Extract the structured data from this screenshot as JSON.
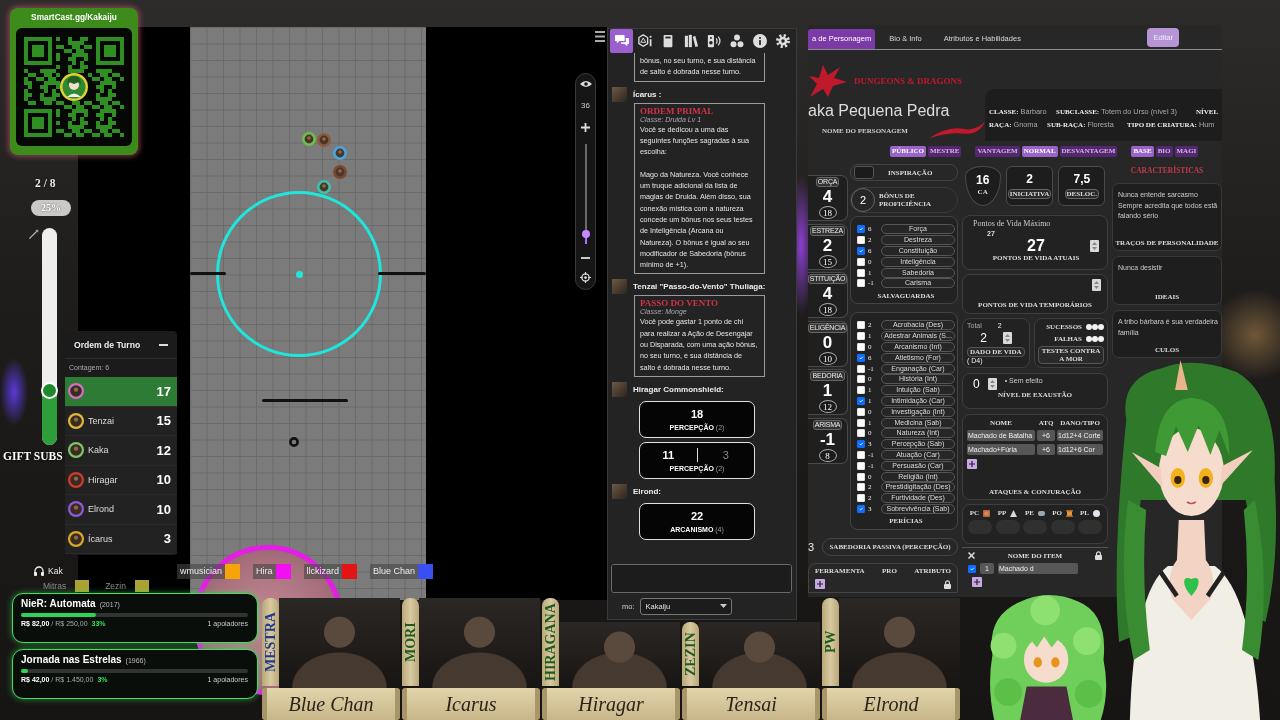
{
  "qr_card": {
    "title": "SmartCast.gg/Kakaiju"
  },
  "sub_goal": {
    "count": "2 / 8",
    "percent": "25%",
    "level": 0.25
  },
  "gift_subs": "GIFT SUBS",
  "map": {
    "zoom": {
      "label": "36",
      "level": 0.1
    },
    "tokens": [
      {
        "color": "#6cc04a"
      },
      {
        "color": "#8a5a3a"
      },
      {
        "color": "#4aa6dc"
      },
      {
        "color": "#7a4a2c"
      },
      {
        "color": "#3fc0a8"
      }
    ]
  },
  "turn_order": {
    "title": "Ordem de Turno",
    "counter": "Contagem: 6",
    "entries": [
      {
        "initiative": "17",
        "color": "#d070c0",
        "selected": true
      },
      {
        "name": "Tenzai",
        "initiative": "15",
        "color": "#e2b83a",
        "selected": false
      },
      {
        "name": "Kaka",
        "initiative": "12",
        "color": "#7cc46a",
        "selected": false
      },
      {
        "name": "Hiragar",
        "initiative": "10",
        "color": "#d23a2a",
        "selected": false
      },
      {
        "name": "Elrond",
        "initiative": "10",
        "color": "#8e5ad8",
        "selected": false
      },
      {
        "name": "Ícarus",
        "initiative": "3",
        "color": "#d8a82a",
        "selected": false
      }
    ]
  },
  "now_playing": "Kak",
  "voice_members": [
    {
      "name": "wmusician",
      "color": "#f5a50a"
    },
    {
      "name": "Hira",
      "color": "#f010f0"
    },
    {
      "name": "llckizard",
      "color": "#e51414"
    },
    {
      "name": "Blue Chan",
      "color": "#3a4ff2"
    }
  ],
  "voice_members_behind": [
    {
      "name": "Mitras",
      "color": "#aaa232"
    },
    {
      "name": "Zezin",
      "color": "#aaa232"
    }
  ],
  "goals": [
    {
      "title": "NieR: Automata",
      "year": "(2017)",
      "level": 0.33,
      "amounts": "**R$ 82,00** / R$ 250,00",
      "percent": "33%",
      "supporters": "1 apoiadores"
    },
    {
      "title": "Jornada nas Estrelas",
      "year": "(1966)",
      "level": 0.03,
      "amounts": "**R$ 42,00** / R$ 1.450,00",
      "percent": "3%",
      "supporters": "1 apoiadores"
    }
  ],
  "chat": {
    "tabs": [
      {
        "selected": true
      },
      {
        "selected": false
      },
      {
        "selected": false
      },
      {
        "selected": false
      },
      {
        "selected": false
      },
      {
        "selected": false
      },
      {
        "selected": false
      },
      {
        "selected": false
      }
    ],
    "messages": [
      {
        "kind": "card",
        "paragraphs": [
          "bônus, no seu turno, e sua distância de salto é dobrada nesse turno."
        ]
      },
      {
        "kind": "card",
        "sender": "Ícarus :",
        "title": "ORDEM PRIMAL",
        "subtitle": "Classe: Druida Lv 1",
        "paragraphs": [
          "Você se dedicou a uma das seguintes funções sagradas à sua escolha:",
          "Mago da Natureza. Você conhece um truque adicional da lista de magias de Druida. Além disso, sua conexão mística com a natureza concede um bônus nos seus testes de Inteligência (Arcana ou Natureza). O bônus é igual ao seu modificador de Sabedoria (bônus mínimo de +1)."
        ]
      },
      {
        "kind": "card",
        "sender": "Tenzai \"Passo-do-Vento\" Thuliaga:",
        "title": "PASSO DO VENTO",
        "subtitle": "Classe: Monge",
        "paragraphs": [
          "Você pode gastar 1 ponto de chi para realizar a Ação de Desengajar ou Disparada, com uma ação bônus, no seu turno, e sua distância de salto é dobrada nesse turno."
        ]
      },
      {
        "kind": "roll",
        "sender": "Hiragar Commonshield:",
        "rolls": [
          {
            "results": [
              {
                "value": "18",
                "dropped": false
              }
            ],
            "label": "**PERCEPÇÃO** (2)"
          },
          {
            "results": [
              {
                "value": "11",
                "dropped": false
              },
              {
                "value": "3",
                "dropped": true
              }
            ],
            "label": "**PERCEPÇÃO** (2)"
          }
        ]
      },
      {
        "kind": "roll",
        "sender": "Elrond:",
        "rolls": [
          {
            "results": [
              {
                "value": "22",
                "dropped": false
              }
            ],
            "label": "**ARCANISMO** (4)"
          }
        ]
      }
    ],
    "speaker": {
      "label": "mo:",
      "value": "Kakaiju"
    }
  },
  "sheet": {
    "tabs": [
      {
        "label": "a de Personagem",
        "selected": true
      },
      {
        "label": "Bio & Info",
        "selected": false
      },
      {
        "label": "Atributos e Habilidades",
        "selected": false
      }
    ],
    "edit_label": "Editar",
    "logo": "DUNGEONS & DRAGONS",
    "character_name": "aka Pequena Pedra",
    "name_caption": "NOME DO PERSONAGEM",
    "info": [
      {
        "label": "CLASSE:",
        "value": "Bárbaro"
      },
      {
        "label": "SUBCLASSE:",
        "value": "Totem do Urso (nível 3)"
      },
      {
        "label": "NÍVEL"
      },
      {
        "label": "RAÇA:",
        "value": "Gnoma"
      },
      {
        "label": "SUB-RAÇA:",
        "value": "Floresta"
      },
      {
        "label": "TIPO DE CRIATURA:",
        "value": "Hum"
      }
    ],
    "toggle_groups": [
      {
        "options": [
          {
            "label": "PÚBLICO",
            "selected": true
          },
          {
            "label": "MESTRE",
            "selected": false
          }
        ]
      },
      {
        "options": [
          {
            "label": "VANTAGEM",
            "selected": false
          },
          {
            "label": "NORMAL",
            "selected": true
          },
          {
            "label": "DESVANTAGEM",
            "selected": false
          }
        ]
      },
      {
        "options": [
          {
            "label": "BASE",
            "selected": true
          },
          {
            "label": "BIO",
            "selected": false
          },
          {
            "label": "MAGI",
            "selected": false
          }
        ]
      }
    ],
    "abilities": [
      {
        "name": "ORÇA",
        "modifier": "4",
        "score": "18"
      },
      {
        "name": "ESTREZA",
        "modifier": "2",
        "score": "15"
      },
      {
        "name": "STITUIÇÃO",
        "modifier": "4",
        "score": "18"
      },
      {
        "name": "ELIGÊNCIA",
        "modifier": "0",
        "score": "10"
      },
      {
        "name": "BEDORIA",
        "modifier": "1",
        "score": "12"
      },
      {
        "name": "ARISMA",
        "modifier": "-1",
        "score": "8"
      }
    ],
    "inspiration": "INSPIRAÇÃO",
    "proficiency": {
      "value": "2",
      "label": "BÔNUS DE PROFICIÊNCIA"
    },
    "saves": {
      "title": "SALVAGUARDAS",
      "items": [
        {
          "value": "6",
          "name": "Força",
          "checked": true
        },
        {
          "value": "2",
          "name": "Destreza",
          "checked": false
        },
        {
          "value": "6",
          "name": "Constituição",
          "checked": true
        },
        {
          "value": "0",
          "name": "Inteligência",
          "checked": false
        },
        {
          "value": "1",
          "name": "Sabedoria",
          "checked": false
        },
        {
          "value": "-1",
          "name": "Carisma",
          "checked": false
        }
      ]
    },
    "skills": {
      "title": "PERÍCIAS",
      "items": [
        {
          "value": "2",
          "name": "Acrobacia (Des)",
          "checked": false
        },
        {
          "value": "1",
          "name": "Adestrar Animais (S...",
          "checked": false
        },
        {
          "value": "0",
          "name": "Arcanismo (Int)",
          "checked": false
        },
        {
          "value": "6",
          "name": "Atletismo (For)",
          "checked": true
        },
        {
          "value": "-1",
          "name": "Enganação (Car)",
          "checked": false
        },
        {
          "value": "0",
          "name": "História (Int)",
          "checked": false
        },
        {
          "value": "1",
          "name": "Intuição (Sab)",
          "checked": false
        },
        {
          "value": "1",
          "name": "Intimidação (Car)",
          "checked": true
        },
        {
          "value": "0",
          "name": "Investigação (Int)",
          "checked": false
        },
        {
          "value": "1",
          "name": "Medicina (Sab)",
          "checked": false
        },
        {
          "value": "0",
          "name": "Natureza (Int)",
          "checked": false
        },
        {
          "value": "3",
          "name": "Percepção (Sab)",
          "checked": true
        },
        {
          "value": "-1",
          "name": "Atuação (Car)",
          "checked": false
        },
        {
          "value": "-1",
          "name": "Persuasão (Car)",
          "checked": false
        },
        {
          "value": "0",
          "name": "Religião (Int)",
          "checked": false
        },
        {
          "value": "2",
          "name": "Prestidigitação (Des)",
          "checked": false
        },
        {
          "value": "2",
          "name": "Furtividade (Des)",
          "checked": false
        },
        {
          "value": "3",
          "name": "Sobrevivência (Sab)",
          "checked": true
        }
      ]
    },
    "passive": {
      "value": "3",
      "label": "SABEDORIA PASSIVA (PERCEPÇÃO)"
    },
    "tools": {
      "columns": [
        "FERRAMENTA",
        "PRO",
        "ATRIBUTO"
      ]
    },
    "combat": [
      {
        "kind": "shield",
        "value": "16",
        "label": "CA"
      },
      {
        "kind": "box",
        "value": "2",
        "label": "INICIATIVA"
      },
      {
        "kind": "box",
        "value": "7,5",
        "label": "DESLOC."
      }
    ],
    "hit_points": {
      "max_label": "Pontos de Vida Máximo",
      "max": "27",
      "current": "27",
      "current_label": "PONTOS DE VIDA ATUAIS",
      "temp_label": "PONTOS DE VIDA TEMPORÁRIOS"
    },
    "hit_dice": {
      "total_label": "Total",
      "total": "2",
      "current": "2",
      "label": "DADO DE VIDA",
      "die": "( D4)"
    },
    "death_saves": {
      "successes_label": "SUCESSOS",
      "failures_label": "FALHAS",
      "label": "TESTES CONTRA A MOR"
    },
    "exhaustion": {
      "value": "0",
      "effect": "• Sem efeito",
      "label": "NÍVEL DE EXAUSTÃO"
    },
    "attacks": {
      "columns": [
        "NOME",
        "ATQ",
        "DANO/TIPO"
      ],
      "rows": [
        {
          "name": "Machado de Batalha",
          "bonus": "+6",
          "damage": "1d12+4 Corte"
        },
        {
          "name": "Machado+Fúria",
          "bonus": "+6",
          "damage": "1d12+6 Cor"
        }
      ],
      "title": "ATAQUES & CONJURAÇÃO"
    },
    "coins": [
      "PC",
      "PP",
      "PE",
      "PO",
      "PL"
    ],
    "inventory": {
      "column": "NOME DO ITEM",
      "items": [
        {
          "checked": true,
          "quantity": "1",
          "name": "Machado d"
        }
      ]
    },
    "traits": {
      "title": "CARACTERÍSTICAS",
      "sections": [
        {
          "lines": [
            "Nunca entende sarcasmo",
            "Sempre acredita que todos estã",
            "falando sério"
          ],
          "label": "TRAÇOS DE PERSONALIDADE"
        },
        {
          "lines": [
            "Nunca desistir"
          ],
          "label": "IDEAIS"
        },
        {
          "lines": [
            "A tribo bárbara é sua verdadeira",
            "família"
          ],
          "label": "CULOS"
        }
      ]
    }
  },
  "cast": [
    {
      "tag": "MESTRA",
      "kind": "master",
      "name": "Blue Chan"
    },
    {
      "tag": "MORI",
      "kind": "player",
      "name": "Icarus"
    },
    {
      "tag": "HIRAGANA",
      "kind": "player",
      "name": "Hiragar"
    },
    {
      "tag": "ZEZIN",
      "kind": "player",
      "name": "Tensai"
    },
    {
      "tag": "PW",
      "kind": "player",
      "name": "Elrond"
    }
  ]
}
